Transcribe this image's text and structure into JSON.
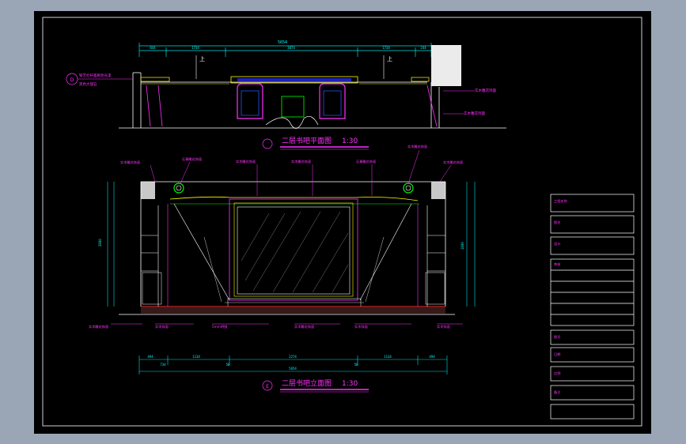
{
  "plan": {
    "title": "二层书吧平面图",
    "scale": "1:30",
    "overall_dim": "5654",
    "segments": [
      "844",
      "1734",
      "3074",
      "1734",
      "244"
    ],
    "up_left": "上",
    "up_right": "上",
    "note_left_1": "铁艺栏杆面刷亮光漆",
    "note_left_2": "黑色大理石",
    "note_right_1": "实木雕花饰面",
    "note_right_2": "实木雕花饰面",
    "mark": "D"
  },
  "elev": {
    "title": "二层书吧立面图",
    "scale": "1:30",
    "overall_dim": "5654",
    "bottom_dims": [
      "494",
      "1134",
      "2274",
      "1134",
      "494"
    ],
    "sub_left": "734",
    "sub_mid_l": "50",
    "sub_mid_r": "50",
    "height_dim": "2800",
    "height_r": "1800",
    "mark": "E",
    "notes_top": [
      "实木雕花饰面",
      "石膏雕花饰面",
      "实木雕花饰面",
      "实木雕花饰面",
      "石膏雕花饰面",
      "实木雕花饰面",
      "实木雕花饰面"
    ],
    "notes_bottom": [
      "实木雕花饰面",
      "实木饰面",
      "5mm明镜",
      "实木雕花饰面",
      "实木饰面",
      "实木饰面"
    ]
  },
  "titleblock": {
    "rows": [
      "工程名称",
      "图名",
      "设计",
      "审核",
      "图号",
      "日期",
      "比例",
      "备注"
    ]
  }
}
